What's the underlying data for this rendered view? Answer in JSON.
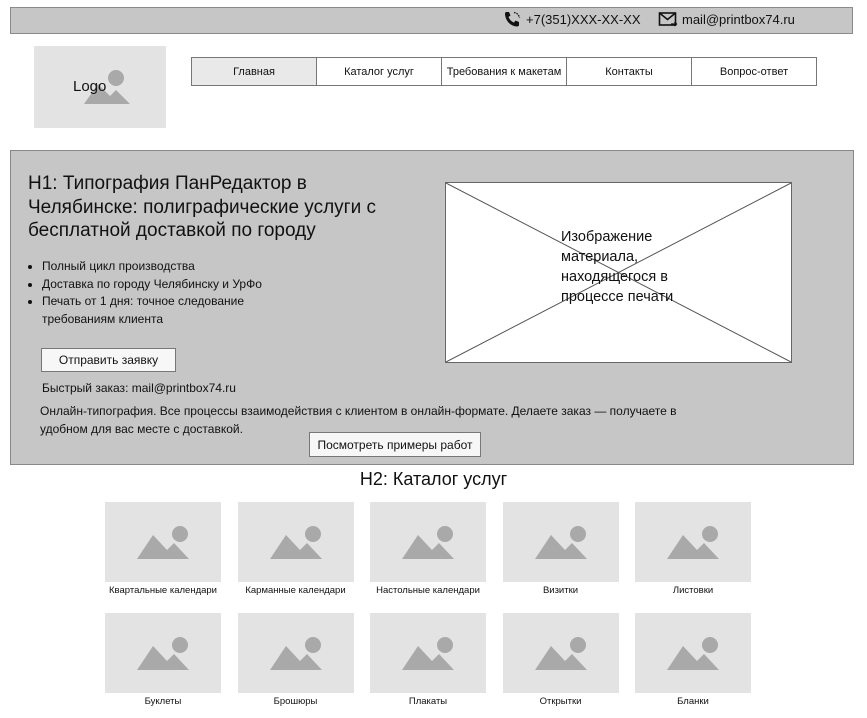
{
  "header": {
    "phone": "+7(351)XXX-XX-XX",
    "email": "mail@printbox74.ru",
    "phone_icon": "phone-icon",
    "mail_icon": "mail-icon"
  },
  "logo": {
    "label": "Logo"
  },
  "nav": {
    "items": [
      {
        "label": "Главная"
      },
      {
        "label": "Каталог услуг"
      },
      {
        "label": "Требования к макетам"
      },
      {
        "label": "Контакты"
      },
      {
        "label": "Вопрос-ответ"
      }
    ]
  },
  "hero": {
    "title": "H1: Типография ПанРедактор в Челябинске: полиграфические услуги с бесплатной доставкой по городу",
    "bullets": [
      "Полный цикл производства",
      "Доставка по городу Челябинску и УрФо",
      "Печать от 1 дня: точное следование требованиям клиента"
    ],
    "order_button": "Отправить заявку",
    "quick_order": "Быстрый заказ: mail@printbox74.ru",
    "description": "Онлайн-типография. Все процессы взаимодействия с клиентом в онлайн-формате. Делаете заказ — получаете в удобном для вас месте с доставкой.",
    "examples_button": "Посмотреть примеры работ",
    "image_placeholder": "Изображение материала, находящегося в процессе печати"
  },
  "catalog": {
    "title": "H2: Каталог услуг",
    "items": [
      {
        "label": "Квартальные календари"
      },
      {
        "label": "Карманные  календари"
      },
      {
        "label": "Настольные календари"
      },
      {
        "label": "Визитки"
      },
      {
        "label": "Листовки"
      },
      {
        "label": "Буклеты"
      },
      {
        "label": "Брошюры"
      },
      {
        "label": "Плакаты"
      },
      {
        "label": "Открытки"
      },
      {
        "label": "Бланки"
      }
    ]
  },
  "colors": {
    "bar_bg": "#c6c6c6",
    "placeholder_bg": "#e3e3e3",
    "placeholder_icon": "#a9a9a9"
  }
}
